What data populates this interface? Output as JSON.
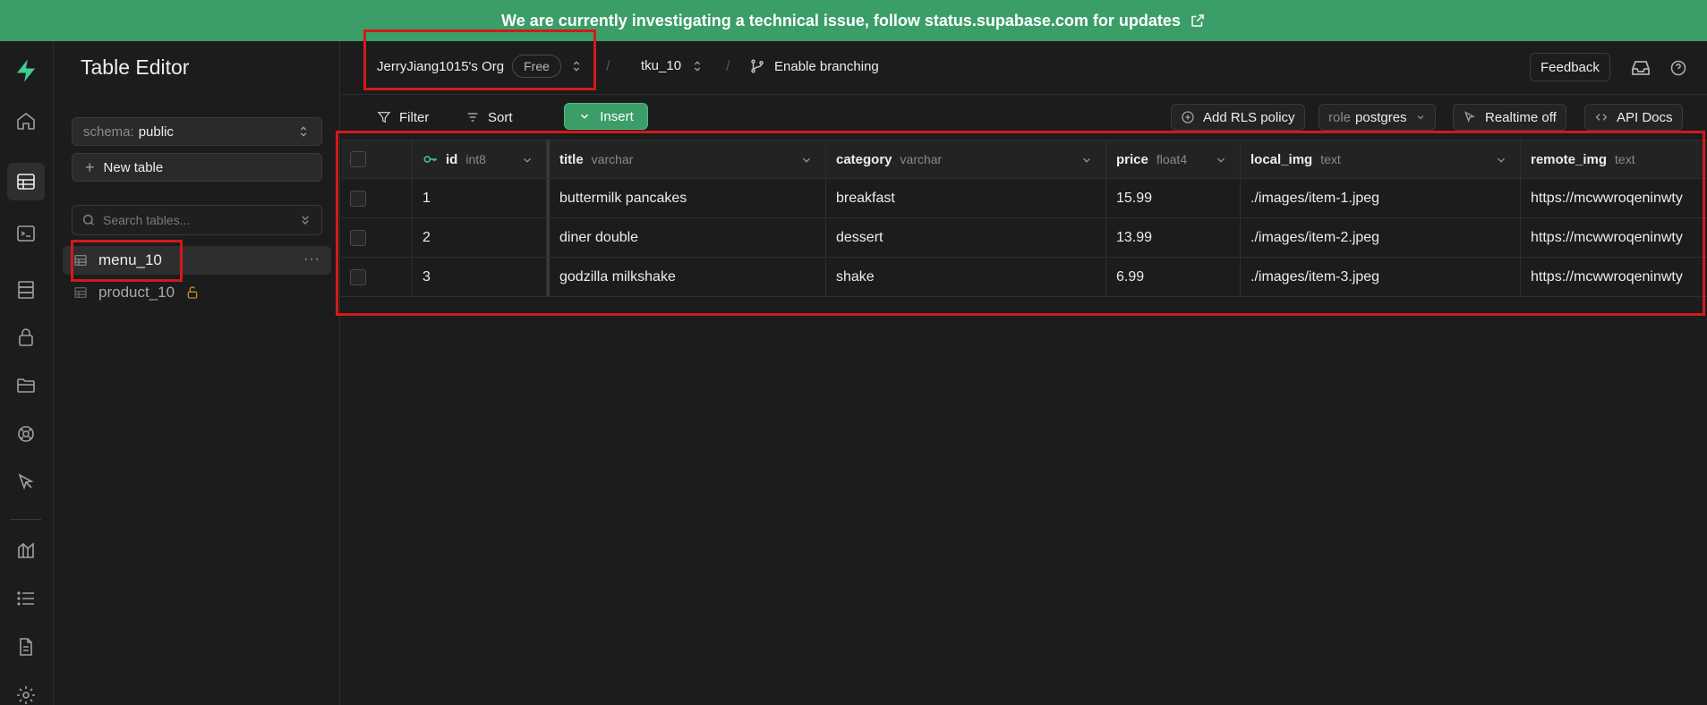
{
  "banner": {
    "text": "We are currently investigating a technical issue, follow status.supabase.com for updates",
    "icon": "external-link-icon"
  },
  "rail": {
    "icons": [
      "supabase-logo-icon",
      "home-icon",
      "table-editor-icon",
      "sql-editor-icon",
      "database-icon",
      "auth-icon",
      "storage-icon",
      "realtime-icon",
      "edge-functions-icon",
      "reports-icon",
      "logs-icon",
      "docs-icon",
      "settings-icon"
    ],
    "active": "table-editor-icon"
  },
  "sidebar": {
    "title": "Table Editor",
    "schema_label": "schema:",
    "schema_value": "public",
    "new_table": "New table",
    "search_placeholder": "Search tables...",
    "tables": [
      {
        "name": "menu_10",
        "active": true
      },
      {
        "name": "product_10",
        "active": false,
        "locked": true
      }
    ]
  },
  "header": {
    "org": "JerryJiang1015's Org",
    "plan": "Free",
    "project": "tku_10",
    "branching": "Enable branching",
    "feedback": "Feedback"
  },
  "toolbar": {
    "filter": "Filter",
    "sort": "Sort",
    "insert": "Insert",
    "add_rls": "Add RLS policy",
    "role_label": "role",
    "role_value": "postgres",
    "realtime": "Realtime off",
    "api_docs": "API Docs"
  },
  "grid": {
    "columns": [
      {
        "name": "id",
        "type": "int8",
        "primary": true
      },
      {
        "name": "title",
        "type": "varchar"
      },
      {
        "name": "category",
        "type": "varchar"
      },
      {
        "name": "price",
        "type": "float4"
      },
      {
        "name": "local_img",
        "type": "text"
      },
      {
        "name": "remote_img",
        "type": "text"
      }
    ],
    "rows": [
      [
        "1",
        "buttermilk pancakes",
        "breakfast",
        "15.99",
        "./images/item-1.jpeg",
        "https://mcwwroqeninwty"
      ],
      [
        "2",
        "diner double",
        "dessert",
        "13.99",
        "./images/item-2.jpeg",
        "https://mcwwroqeninwty"
      ],
      [
        "3",
        "godzilla milkshake",
        "shake",
        "6.99",
        "./images/item-3.jpeg",
        "https://mcwwroqeninwty"
      ]
    ]
  },
  "colors": {
    "brand": "#3b9e68",
    "annotation": "#d11a1a",
    "background": "#1c1c1c"
  }
}
